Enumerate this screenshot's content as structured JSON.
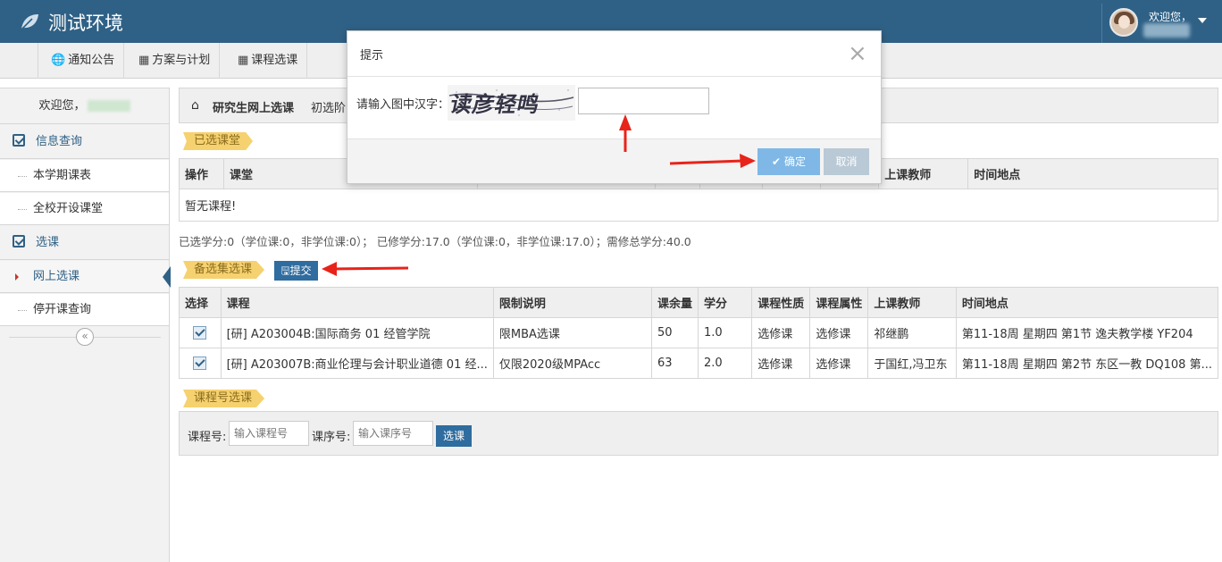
{
  "header": {
    "title": "测试环境",
    "welcome": "欢迎您，",
    "logo_icon": "leaf-icon",
    "avatar_icon": "user-avatar"
  },
  "topnav": {
    "items": [
      {
        "label": "通知公告",
        "icon": "globe-icon"
      },
      {
        "label": "方案与计划",
        "icon": "calendar-icon"
      },
      {
        "label": "课程选课",
        "icon": "calendar-icon"
      }
    ]
  },
  "sidebar": {
    "welcome": "欢迎您，",
    "groups": [
      {
        "label": "信息查询",
        "items": [
          "本学期课表",
          "全校开设课堂"
        ]
      },
      {
        "label": "选课",
        "items": [
          "网上选课",
          "停开课查询"
        ]
      }
    ],
    "active_item": "网上选课",
    "collapse_glyph": "«"
  },
  "breadcrumb": {
    "title": "研究生网上选课",
    "stage": "初选阶"
  },
  "selected_section": {
    "tag": "已选课堂",
    "headers": [
      "操作",
      "课堂",
      "",
      "",
      "",
      "",
      "",
      "上课教师",
      "时间地点"
    ],
    "empty_text": "暂无课程!"
  },
  "credit_info": "已选学分:0（学位课:0，非学位课:0）； 已修学分:17.0（学位课:0，非学位课:17.0）；需修总学分:40.0",
  "candidate_section": {
    "tag": "备选集选课",
    "submit_label": "提交",
    "headers": [
      "选择",
      "课程",
      "限制说明",
      "课余量",
      "学分",
      "课程性质",
      "课程属性",
      "上课教师",
      "时间地点"
    ],
    "rows": [
      {
        "checked": true,
        "course": "[研] A203004B:国际商务 01 经管学院",
        "limit": "限MBA选课",
        "remain": "50",
        "credit": "1.0",
        "nature": "选修课",
        "attr": "选修课",
        "teacher": "祁继鹏",
        "time_place": "第11-18周 星期四 第1节 逸夫教学楼 YF204"
      },
      {
        "checked": true,
        "course": "[研] A203007B:商业伦理与会计职业道德 01 经...",
        "limit": "仅限2020级MPAcc",
        "remain": "63",
        "credit": "2.0",
        "nature": "选修课",
        "attr": "选修课",
        "teacher": "于国红,冯卫东",
        "time_place": "第11-18周 星期四 第2节 东区一教 DQ108 第..."
      }
    ]
  },
  "course_no_section": {
    "tag": "课程号选课",
    "course_no_label": "课程号:",
    "course_no_placeholder": "输入课程号",
    "seq_no_label": "课序号:",
    "seq_no_placeholder": "输入课序号",
    "pick_label": "选课"
  },
  "dialog": {
    "title": "提示",
    "close_glyph": "×",
    "prompt": "请输入图中汉字：",
    "captcha_text": "读彦轻鸣",
    "ok_label": "确定",
    "cancel_label": "取消"
  },
  "colors": {
    "header_bg": "#2f6186",
    "accent": "#2f6c9f",
    "tag": "#f6d16f",
    "arrow": "#e8231a"
  }
}
